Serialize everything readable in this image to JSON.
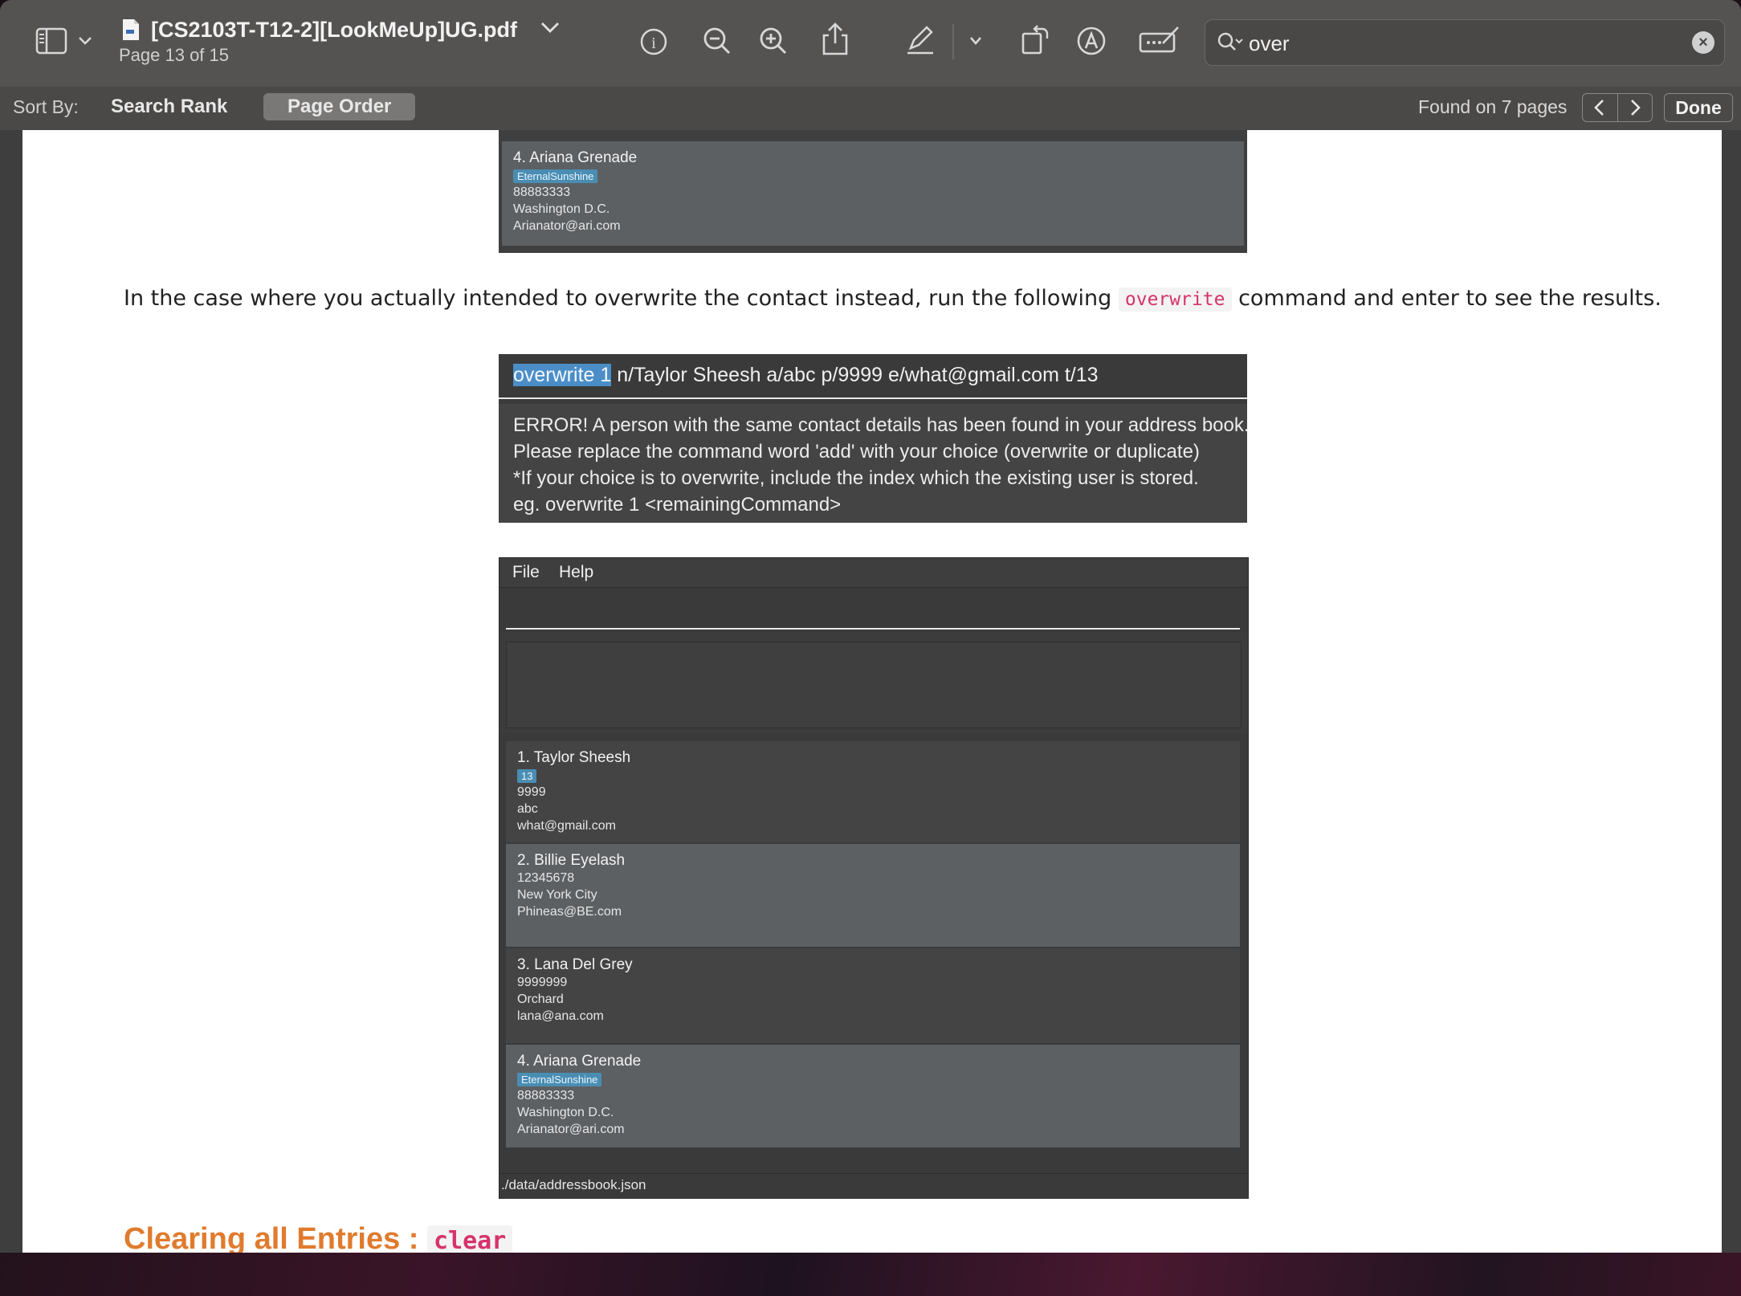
{
  "window": {
    "document_title": "[CS2103T-T12-2][LookMeUp]UG.pdf",
    "page_info": "Page 13 of 15"
  },
  "toolbar": {
    "icons": [
      "sidebar-icon",
      "chevron-down-icon",
      "info-icon",
      "zoom-out-icon",
      "zoom-in-icon",
      "share-icon",
      "highlight-icon",
      "chevron-down-icon",
      "rotate-icon",
      "markup-icon",
      "annotate-icon"
    ]
  },
  "search": {
    "value": "over"
  },
  "findbar": {
    "sort_by_label": "Sort By:",
    "sort_search_rank": "Search Rank",
    "sort_page_order": "Page Order",
    "found_text": "Found on 7 pages",
    "done_label": "Done"
  },
  "content": {
    "top_card": {
      "name": "4.  Ariana Grenade",
      "tag": "EternalSunshine",
      "phone": "88883333",
      "address": "Washington D.C.",
      "email": "Arianator@ari.com"
    },
    "paragraph": {
      "before": "In the case where you actually intended to overwrite the contact instead, run the following ",
      "code": "overwrite",
      "after": " command and enter to see the results."
    },
    "command_box": {
      "highlight": "overwrite 1",
      "rest": " n/Taylor Sheesh a/abc p/9999 e/what@gmail.com t/13",
      "error_lines": [
        "ERROR! A person with the same contact details has been found in your address book.",
        "Please replace the command word 'add' with your choice (overwrite or duplicate)",
        "*If your choice is to overwrite, include the index which the existing user is stored.",
        "eg. overwrite 1 <remainingCommand>"
      ]
    },
    "app": {
      "menu_file": "File",
      "menu_help": "Help",
      "contacts": [
        {
          "name": "1.  Taylor Sheesh",
          "tag": "13",
          "phone": "9999",
          "address": "abc",
          "email": "what@gmail.com"
        },
        {
          "name": "2.  Billie Eyelash",
          "phone": "12345678",
          "address": "New York City",
          "email": "Phineas@BE.com"
        },
        {
          "name": "3.  Lana Del Grey",
          "phone": "9999999",
          "address": "Orchard",
          "email": "lana@ana.com"
        },
        {
          "name": "4.  Ariana Grenade",
          "tag": "EternalSunshine",
          "phone": "88883333",
          "address": "Washington D.C.",
          "email": "Arianator@ari.com"
        }
      ],
      "status_path": "./data/addressbook.json"
    },
    "heading": {
      "text": "Clearing all Entries : ",
      "code": "clear"
    }
  }
}
